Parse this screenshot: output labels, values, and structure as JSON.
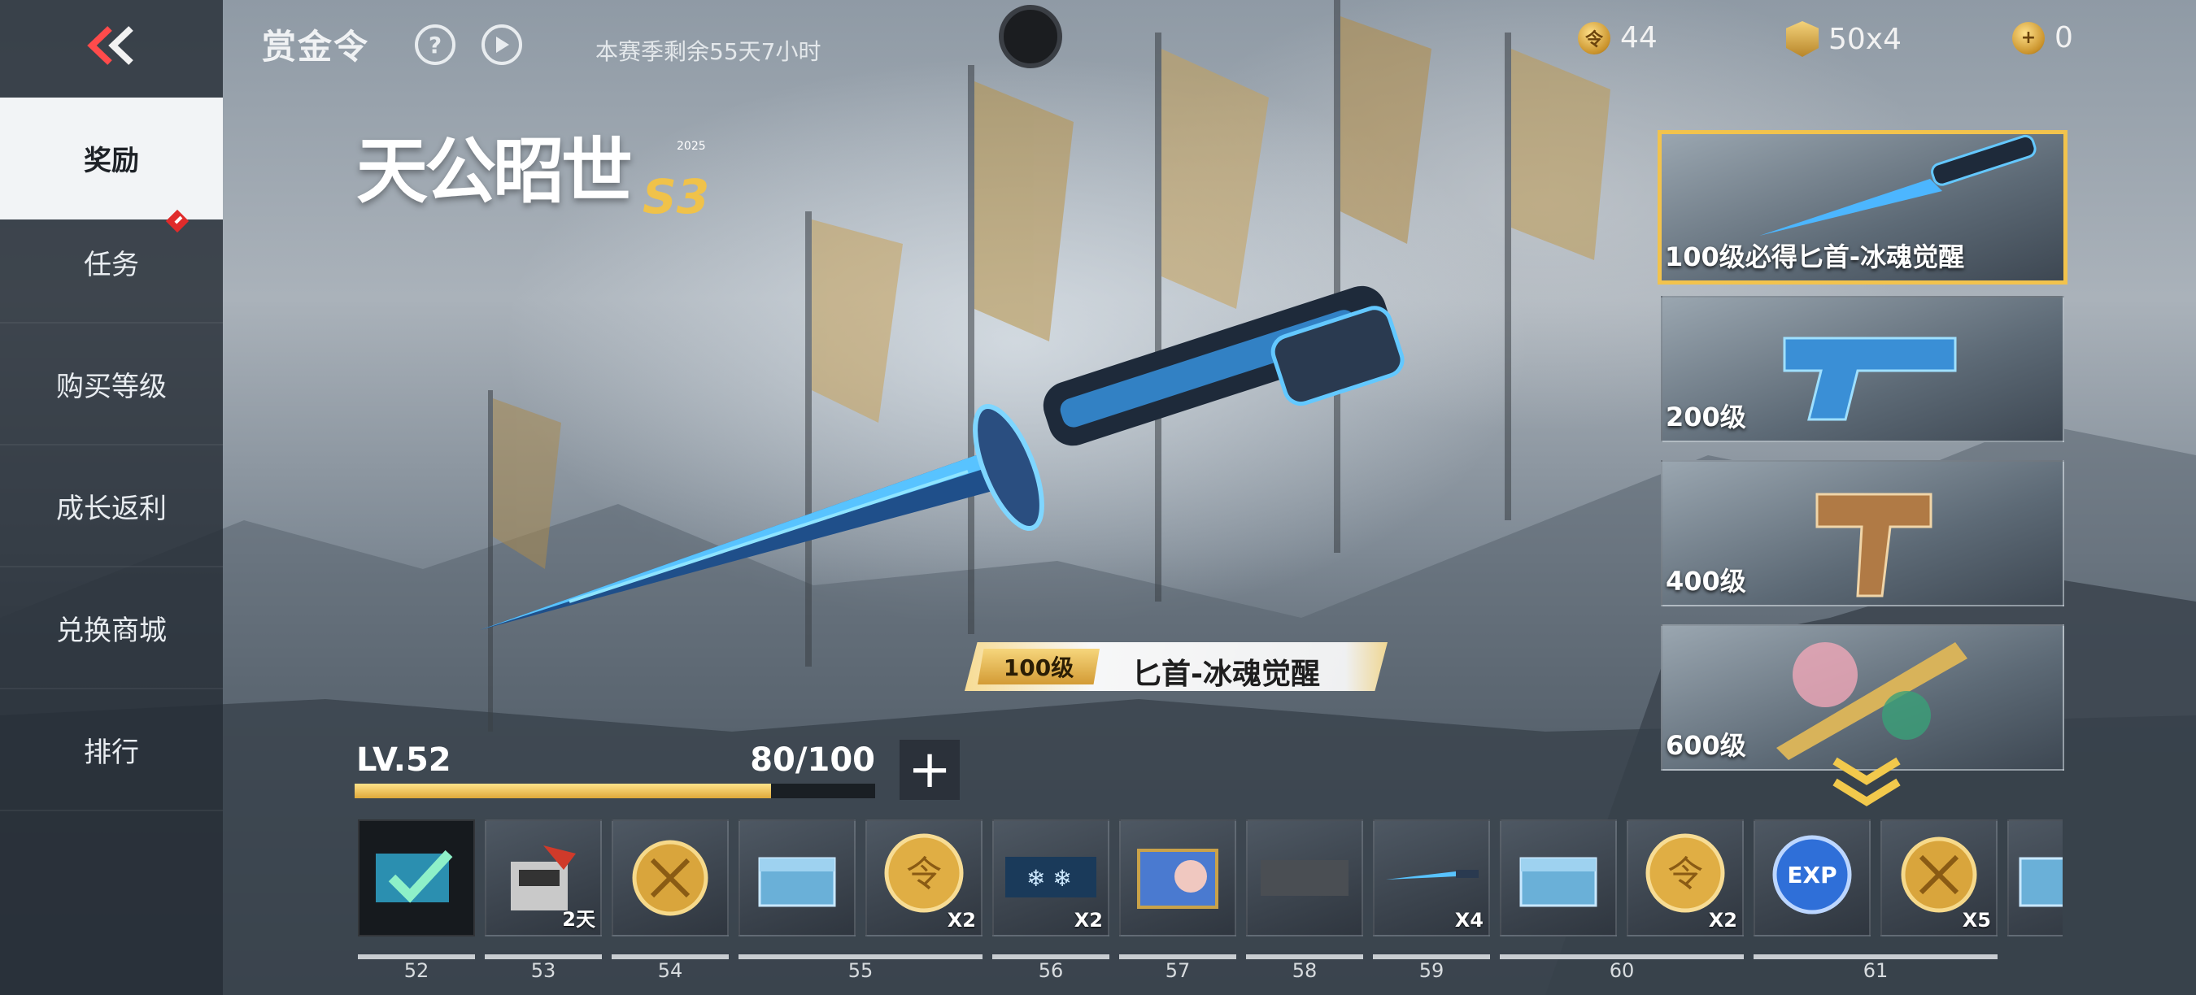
{
  "header": {
    "title": "赏金令",
    "help_icon": "?",
    "season_remaining": "本赛季剩余55天7小时"
  },
  "currencies": [
    {
      "icon": "gold-coin-icon",
      "value": "44"
    },
    {
      "icon": "badge-token-icon",
      "value": "50x4"
    },
    {
      "icon": "plus-coin-icon",
      "value": "0"
    }
  ],
  "sidebar": {
    "items": [
      {
        "label": "奖励",
        "active": true
      },
      {
        "label": "任务",
        "alert": true
      },
      {
        "label": "购买等级"
      },
      {
        "label": "成长返利"
      },
      {
        "label": "兑换商城"
      },
      {
        "label": "排行"
      }
    ]
  },
  "logo": {
    "text": "天公昭世",
    "season": "S3",
    "year": "2025"
  },
  "featured": {
    "level": "100级",
    "name": "匕首-冰魂觉醒"
  },
  "previews": [
    {
      "label": "100级必得匕首-冰魂觉醒",
      "selected": true
    },
    {
      "label": "200级"
    },
    {
      "label": "400级"
    },
    {
      "label": "600级"
    }
  ],
  "level_bar": {
    "level": "LV.52",
    "progress": "80/100",
    "fraction": 0.8,
    "add_icon": "+"
  },
  "track": {
    "slots": [
      {
        "icon": "claimed-weapon-icon",
        "qty": ""
      },
      {
        "icon": "supply-kit-icon",
        "qty": "2天"
      },
      {
        "icon": "gold-token-icon",
        "qty": ""
      },
      {
        "icon": "weapon-crate-icon",
        "qty": ""
      },
      {
        "icon": "gold-coin-icon",
        "qty": "X2"
      },
      {
        "icon": "snowflake-camo-icon",
        "qty": "X2"
      },
      {
        "icon": "character-card-icon",
        "qty": ""
      },
      {
        "icon": "dark-plate-icon",
        "qty": ""
      },
      {
        "icon": "blue-dagger-icon",
        "qty": "X4"
      },
      {
        "icon": "weapon-crate-icon",
        "qty": ""
      },
      {
        "icon": "gold-coin-icon",
        "qty": "X2"
      },
      {
        "icon": "exp-card-icon",
        "qty": ""
      },
      {
        "icon": "gold-token-icon",
        "qty": "X5"
      },
      {
        "icon": "weapon-crate-icon",
        "qty": ""
      }
    ],
    "levels": [
      "52",
      "53",
      "54",
      "55",
      "56",
      "57",
      "58",
      "59",
      "60",
      "61"
    ]
  }
}
